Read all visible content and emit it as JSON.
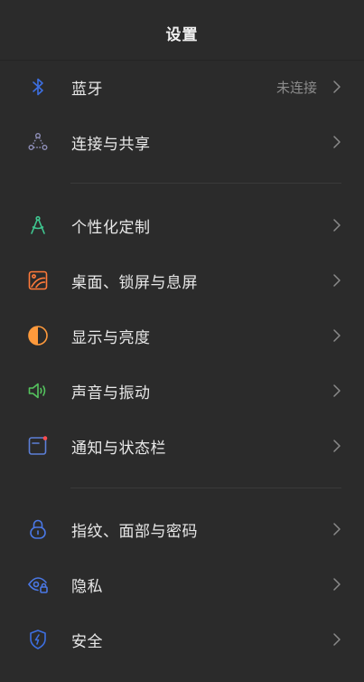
{
  "header": {
    "title": "设置"
  },
  "items": [
    {
      "label": "蓝牙",
      "value": "未连接",
      "icon": "bluetooth-icon",
      "color": "#3d6fe0"
    },
    {
      "label": "连接与共享",
      "icon": "share-icon",
      "color": "#8f8fb8"
    },
    {
      "label": "个性化定制",
      "icon": "compass-icon",
      "color": "#3fc690"
    },
    {
      "label": "桌面、锁屏与息屏",
      "icon": "wallpaper-icon",
      "color": "#ff7a3a"
    },
    {
      "label": "显示与亮度",
      "icon": "contrast-icon",
      "color": "#ff9a3c"
    },
    {
      "label": "声音与振动",
      "icon": "speaker-icon",
      "color": "#55c45e"
    },
    {
      "label": "通知与状态栏",
      "icon": "notification-icon",
      "color": "#5c7fd8"
    },
    {
      "label": "指纹、面部与密码",
      "icon": "lock-icon",
      "color": "#4a78e6"
    },
    {
      "label": "隐私",
      "icon": "eye-lock-icon",
      "color": "#4a78e6"
    },
    {
      "label": "安全",
      "icon": "shield-icon",
      "color": "#3d6fe0"
    }
  ]
}
